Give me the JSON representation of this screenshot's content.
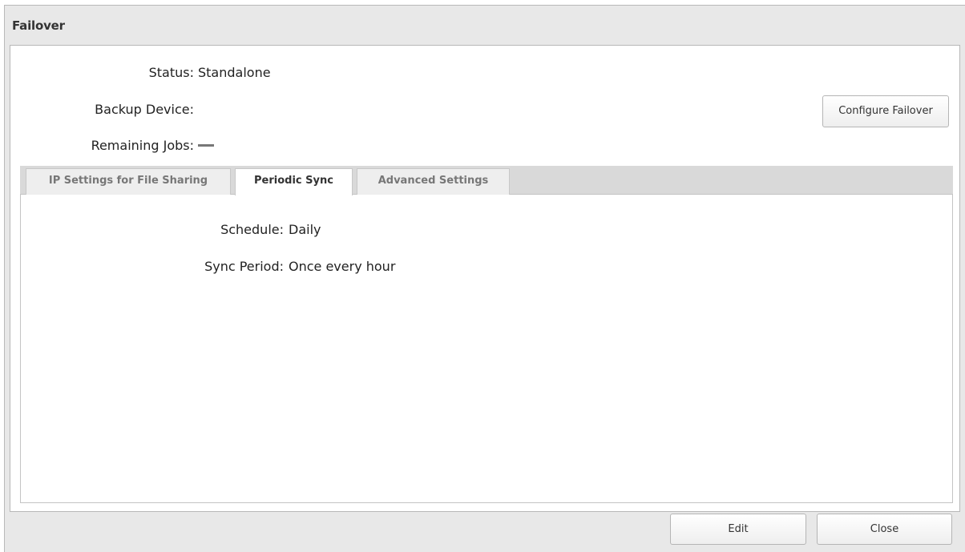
{
  "dialog": {
    "title": "Failover"
  },
  "status": {
    "status_label": "Status:",
    "status_value": "Standalone",
    "backup_device_label": "Backup Device:",
    "backup_device_value": "",
    "remaining_jobs_label": "Remaining Jobs:"
  },
  "buttons": {
    "configure_failover": "Configure Failover",
    "edit": "Edit",
    "close": "Close"
  },
  "tabs": [
    {
      "label": "IP Settings for File Sharing",
      "active": false
    },
    {
      "label": "Periodic Sync",
      "active": true
    },
    {
      "label": "Advanced Settings",
      "active": false
    }
  ],
  "periodic_sync": {
    "schedule_label": "Schedule:",
    "schedule_value": "Daily",
    "sync_period_label": "Sync Period:",
    "sync_period_value": "Once every hour"
  }
}
